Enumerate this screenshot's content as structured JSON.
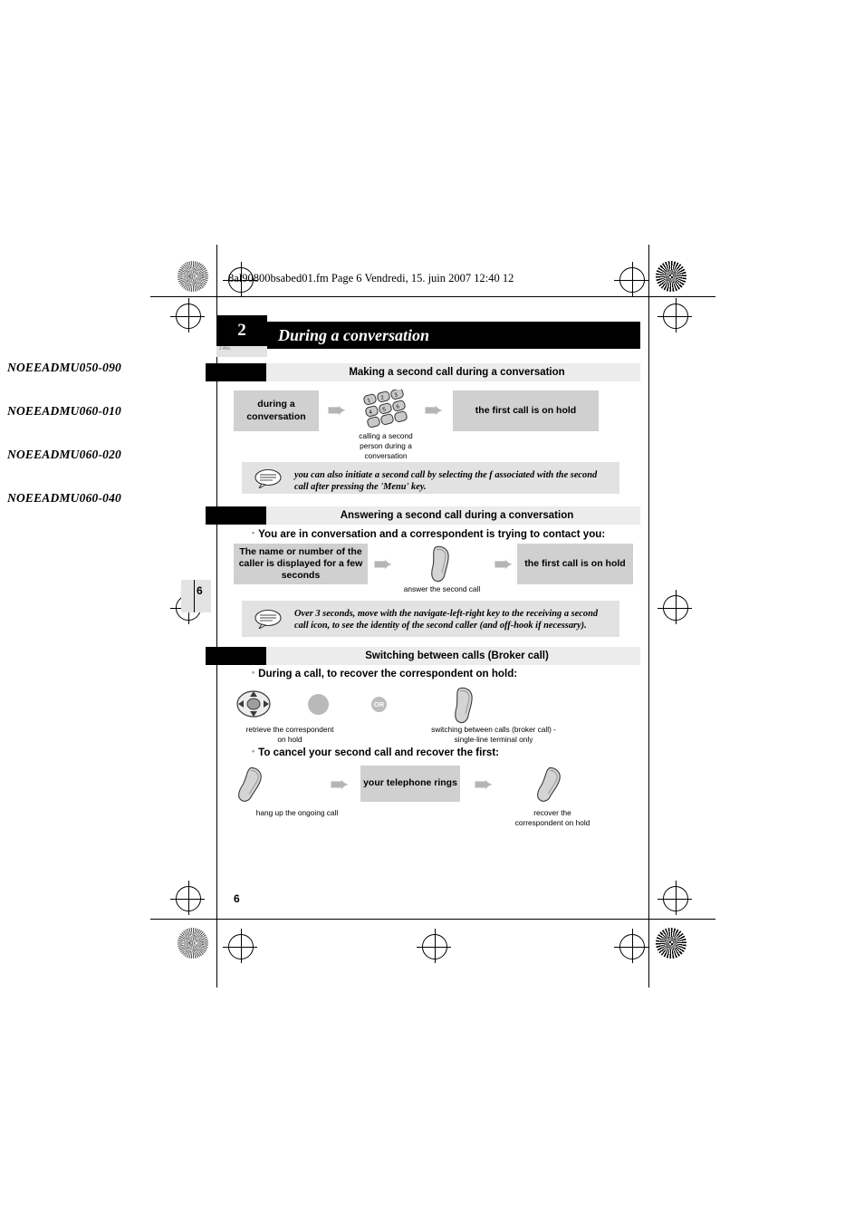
{
  "header": {
    "file_line": "8al90800bsabed01.fm  Page 6  Vendredi, 15. juin 2007  12:40 12"
  },
  "chapter": {
    "number": "2",
    "number_sub": "2 Abc",
    "title": "During a conversation"
  },
  "margin_codes": [
    "NOEEADMU050-090",
    "NOEEADMU060-010",
    "NOEEADMU060-020",
    "NOEEADMU060-040"
  ],
  "page_number": "6",
  "footer_page_number": "6",
  "sections": [
    {
      "id": "making-second-call",
      "title": "Making a second call during a conversation",
      "steps": [
        {
          "label": "during a\nconversation",
          "caption": ""
        },
        {
          "label": "",
          "caption": "calling a second\nperson during a\nconversation"
        },
        {
          "label": "the first call is on hold",
          "caption": ""
        }
      ],
      "note": "you can also initiate a second call by selecting the f              associated with the second call after pressing the 'Menu' key."
    },
    {
      "id": "answering-second-call",
      "title": "Answering a second call during a conversation",
      "bullet": "You are in conversation and a correspondent is trying to contact you:",
      "steps": [
        {
          "label": "The name or number of the caller is displayed for a few seconds",
          "caption": ""
        },
        {
          "label": "",
          "caption": "answer the second call"
        },
        {
          "label": "the first call is on hold",
          "caption": ""
        }
      ],
      "note": "Over 3 seconds, move with the navigate-left-right key to the receiving a second call icon, to see the identity of the second caller (and off-hook if necessary)."
    },
    {
      "id": "switching-between-calls",
      "title": "Switching between calls (Broker call)",
      "bullet_1": "During a call, to recover the correspondent on hold:",
      "row1": {
        "caption_left": "retrieve the correspondent\non hold",
        "or_label": "OR",
        "caption_right": "switching between calls (broker call) -\nsingle-line terminal only"
      },
      "bullet_2": "To cancel your second call and recover the first:",
      "row2": {
        "caption_left": "hang up the ongoing call",
        "box_label": "your telephone rings",
        "caption_right": "recover the\ncorrespondent on hold"
      }
    }
  ],
  "icons": {
    "arrow": "➨",
    "bullet_dot": "•"
  }
}
